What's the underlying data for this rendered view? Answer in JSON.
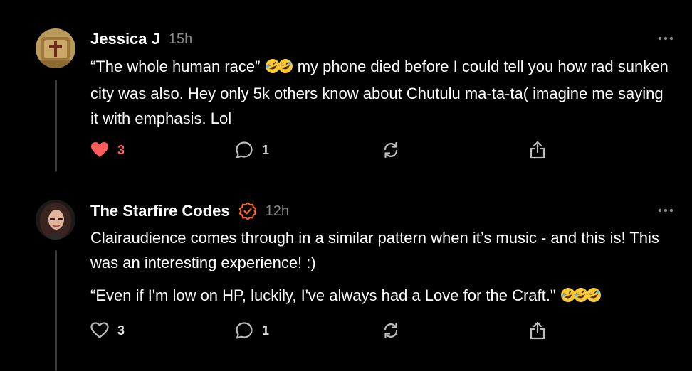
{
  "comments": [
    {
      "author": "Jessica J",
      "time": "15h",
      "verified": false,
      "paragraphs": [
        {
          "before": "“The whole human race”",
          "emoji_count": 2,
          "after": "my phone died before I could tell you how rad sunken city was also. Hey only 5k others know about Chutulu ma-ta-ta( imagine me saying it with emphasis. Lol"
        }
      ],
      "likes": "3",
      "liked": true,
      "replies": "1"
    },
    {
      "author": "The Starfire Codes",
      "time": "12h",
      "verified": true,
      "paragraphs": [
        {
          "before": "Clairaudience comes through in a similar pattern when it’s music - and this is! This was an interesting experience! :)",
          "emoji_count": 0,
          "after": ""
        },
        {
          "before": "“Even if I'm low on HP, luckily, I've always had a Love for the Craft.\"",
          "emoji_count": 3,
          "after": ""
        }
      ],
      "likes": "3",
      "liked": false,
      "replies": "1"
    }
  ],
  "icons": {
    "emoji": "rolling-on-the-floor-laughing-icon",
    "like": "heart-icon",
    "reply": "speech-bubble-icon",
    "restack": "restack-arrows-icon",
    "share": "share-icon",
    "more": "more-dots-icon",
    "verified": "verified-check-icon"
  },
  "colors": {
    "background": "#000000",
    "liked": "#ff5c5c",
    "verified": "#ff6719",
    "muted": "#8a8a8a"
  }
}
